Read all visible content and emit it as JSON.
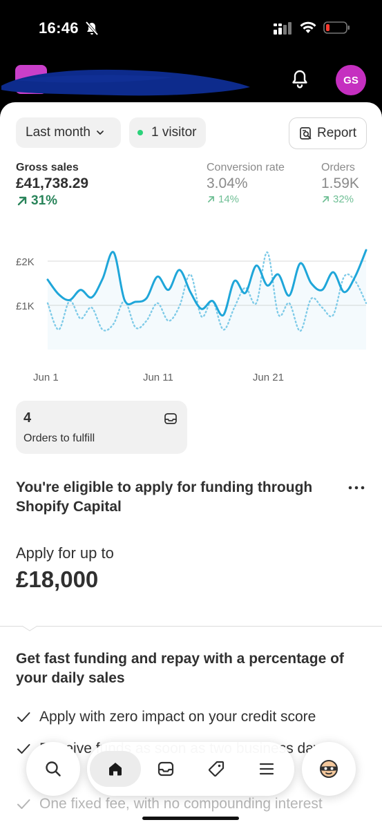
{
  "status_bar": {
    "time": "16:46"
  },
  "header": {
    "avatar_initials": "GS"
  },
  "filters": {
    "period": "Last month",
    "visitors": "1 visitor",
    "report": "Report"
  },
  "metrics": {
    "gross_sales": {
      "label": "Gross sales",
      "value": "£41,738.29",
      "change": "31%"
    },
    "conversion_rate": {
      "label": "Conversion rate",
      "value": "3.04%",
      "change": "14%"
    },
    "orders": {
      "label": "Orders",
      "value": "1.59K",
      "change": "32%"
    }
  },
  "chart_data": {
    "type": "line",
    "y_ticks": [
      "£2K",
      "£1K"
    ],
    "x_ticks": [
      "Jun 1",
      "Jun 11",
      "Jun 21"
    ],
    "ylim": [
      0,
      2500
    ],
    "x": [
      1,
      2,
      3,
      4,
      5,
      6,
      7,
      8,
      9,
      10,
      11,
      12,
      13,
      14,
      15,
      16,
      17,
      18,
      19,
      20,
      21,
      22,
      23,
      24,
      25,
      26,
      27,
      28,
      29,
      30
    ],
    "series": [
      {
        "values": [
          1580,
          1250,
          1120,
          1350,
          1180,
          1600,
          2200,
          1120,
          1080,
          1160,
          1650,
          1350,
          1800,
          1300,
          920,
          1100,
          780,
          1550,
          1280,
          1900,
          1450,
          1700,
          1220,
          1950,
          1500,
          1350,
          1750,
          1300,
          1650,
          2250
        ]
      },
      {
        "values": [
          1050,
          450,
          1100,
          700,
          950,
          450,
          580,
          1100,
          500,
          650,
          1050,
          650,
          980,
          1700,
          750,
          1100,
          450,
          950,
          1400,
          1050,
          2200,
          800,
          1050,
          420,
          1150,
          950,
          780,
          1650,
          1550,
          1050
        ]
      }
    ],
    "grid": true,
    "colors": {
      "current": "#1fa6d9",
      "comparison": "#7fcbe8"
    }
  },
  "fulfill": {
    "count": "4",
    "label": "Orders to fulfill"
  },
  "capital": {
    "title": "You're eligible to apply for funding through Shopify Capital",
    "apply_label": "Apply for up to",
    "amount": "£18,000"
  },
  "funding": {
    "title": "Get fast funding and repay with a percentage of your daily sales",
    "benefits": [
      "Apply with zero impact on your credit score",
      "Receive funds as soon as two business days",
      "One fixed fee, with no compounding interest"
    ]
  },
  "nav": {
    "items": [
      "search",
      "home",
      "orders",
      "products",
      "menu",
      "profile"
    ]
  }
}
